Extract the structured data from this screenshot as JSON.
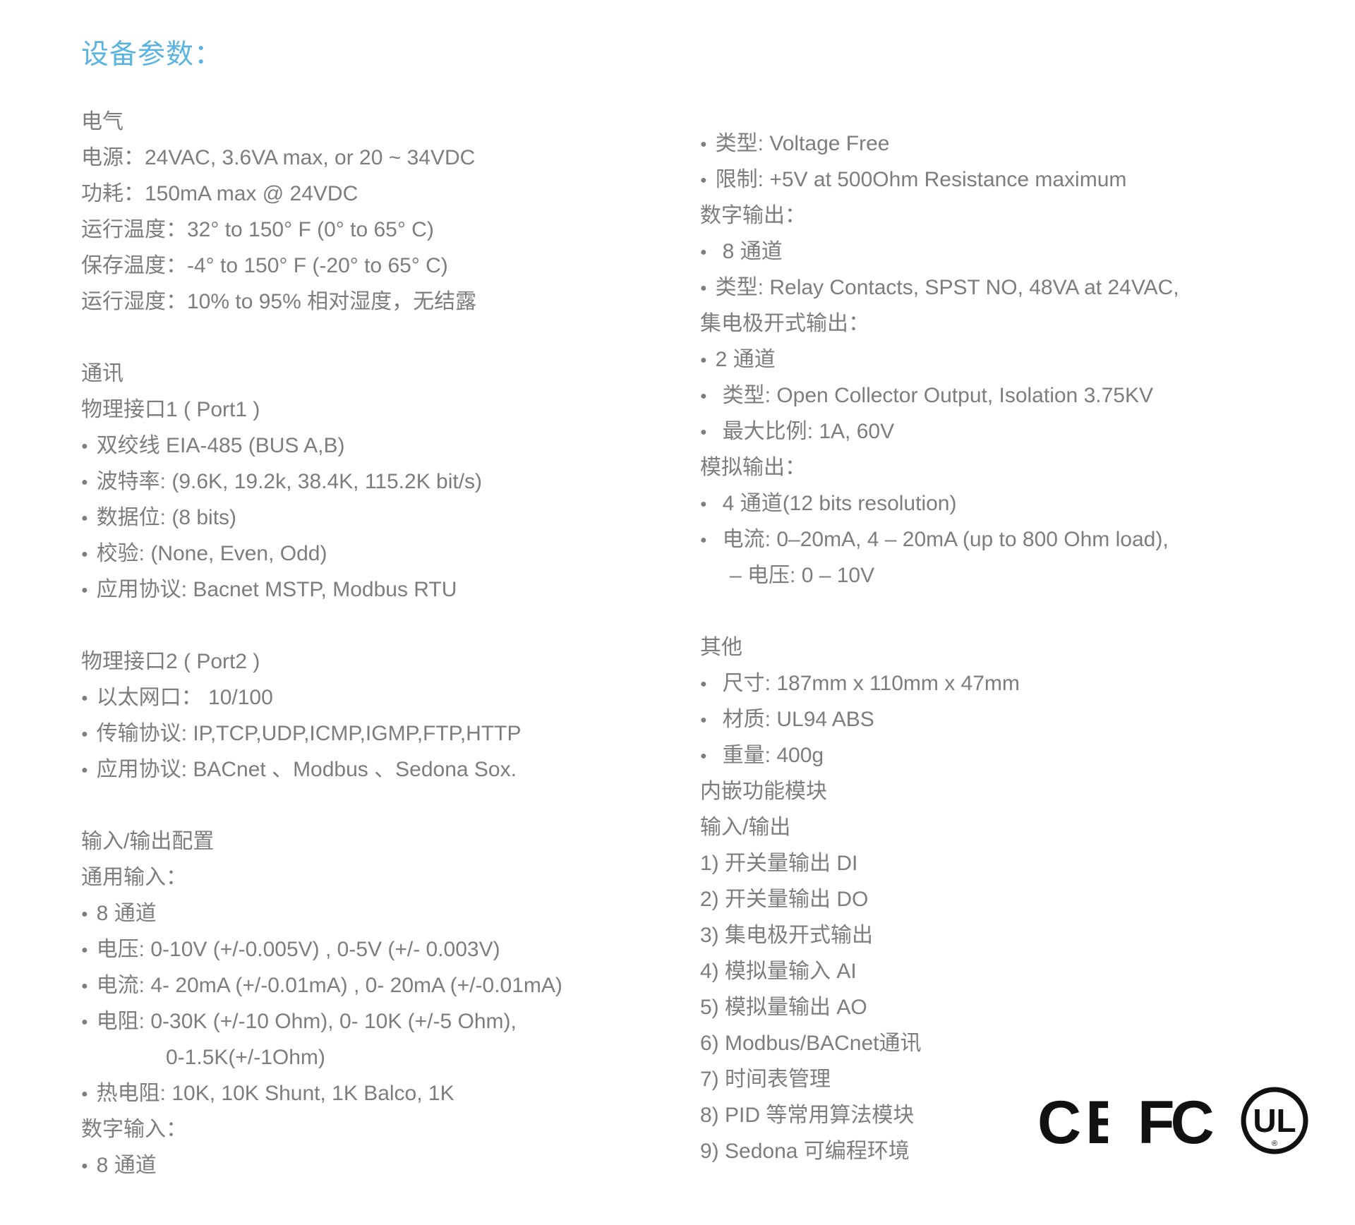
{
  "title": "设备参数：",
  "left_column": [
    {
      "text": "电气",
      "bullet": false
    },
    {
      "text": "电源：24VAC, 3.6VA max, or 20 ~ 34VDC",
      "bullet": false
    },
    {
      "text": "功耗：150mA max @ 24VDC",
      "bullet": false
    },
    {
      "text": "运行温度：32° to 150° F (0° to 65° C)",
      "bullet": false
    },
    {
      "text": "保存温度：-4° to 150° F (-20° to 65° C)",
      "bullet": false
    },
    {
      "text": "运行湿度：10% to 95% 相对湿度，无结露",
      "bullet": false
    },
    {
      "text": "",
      "gap": true
    },
    {
      "text": "通讯",
      "bullet": false
    },
    {
      "text": "物理接口1 ( Port1 )",
      "bullet": false
    },
    {
      "text": "双绞线 EIA-485 (BUS A,B)",
      "bullet": true
    },
    {
      "text": "波特率: (9.6K, 19.2k, 38.4K, 115.2K bit/s)",
      "bullet": true
    },
    {
      "text": "数据位: (8 bits)",
      "bullet": true
    },
    {
      "text": "校验: (None, Even, Odd)",
      "bullet": true
    },
    {
      "text": "应用协议: Bacnet MSTP, Modbus RTU",
      "bullet": true
    },
    {
      "text": "",
      "gap": true
    },
    {
      "text": "物理接口2 ( Port2 )",
      "bullet": false
    },
    {
      "text": "以太网口： 10/100",
      "bullet": true
    },
    {
      "text": "传输协议: IP,TCP,UDP,ICMP,IGMP,FTP,HTTP",
      "bullet": true
    },
    {
      "text": "应用协议: BACnet 、Modbus 、Sedona Sox.",
      "bullet": true
    },
    {
      "text": "",
      "gap": true
    },
    {
      "text": "输入/输出配置",
      "bullet": false
    },
    {
      "text": "通用输入：",
      "bullet": false
    },
    {
      "text": "8 通道",
      "bullet": true
    },
    {
      "text": "电压: 0-10V (+/-0.005V) , 0-5V (+/- 0.003V)",
      "bullet": true
    },
    {
      "text": "电流: 4- 20mA (+/-0.01mA) , 0- 20mA (+/-0.01mA)",
      "bullet": true
    },
    {
      "text": "电阻: 0-30K (+/-10 Ohm), 0- 10K (+/-5 Ohm),",
      "bullet": true
    },
    {
      "text": "0-1.5K(+/-1Ohm)",
      "bullet": false,
      "indent": true
    },
    {
      "text": "热电阻: 10K, 10K Shunt, 1K Balco, 1K",
      "bullet": true
    },
    {
      "text": "数字输入：",
      "bullet": false
    },
    {
      "text": "8 通道",
      "bullet": true
    }
  ],
  "right_column": [
    {
      "text": "类型: Voltage Free",
      "bullet": true
    },
    {
      "text": "限制: +5V at 500Ohm Resistance maximum",
      "bullet": true
    },
    {
      "text": "数字输出：",
      "bullet": false
    },
    {
      "text": "8 通道",
      "bullet": true,
      "wide": true
    },
    {
      "text": "类型: Relay Contacts, SPST NO, 48VA at 24VAC,",
      "bullet": true
    },
    {
      "text": "集电极开式输出：",
      "bullet": false
    },
    {
      "text": "2 通道",
      "bullet": true
    },
    {
      "text": "类型: Open Collector Output, Isolation 3.75KV",
      "bullet": true,
      "wide": true
    },
    {
      "text": "最大比例: 1A, 60V",
      "bullet": true,
      "wide": true
    },
    {
      "text": "模拟输出：",
      "bullet": false
    },
    {
      "text": "4 通道(12 bits resolution)",
      "bullet": true,
      "wide": true
    },
    {
      "text": "电流: 0–20mA, 4 – 20mA (up to 800 Ohm load),",
      "bullet": true,
      "wide": true
    },
    {
      "text": "– 电压: 0 – 10V",
      "bullet": false,
      "indent": true
    },
    {
      "text": "",
      "gap": true
    },
    {
      "text": "其他",
      "bullet": false
    },
    {
      "text": "尺寸: 187mm x 110mm x 47mm",
      "bullet": true,
      "wide": true
    },
    {
      "text": "材质: UL94 ABS",
      "bullet": true,
      "wide": true
    },
    {
      "text": "重量: 400g",
      "bullet": true,
      "wide": true
    },
    {
      "text": "内嵌功能模块",
      "bullet": false
    },
    {
      "text": "输入/输出",
      "bullet": false
    },
    {
      "text": "1) 开关量输出 DI",
      "bullet": false
    },
    {
      "text": "2) 开关量输出 DO",
      "bullet": false
    },
    {
      "text": "3) 集电极开式输出",
      "bullet": false
    },
    {
      "text": "4) 模拟量输入 AI",
      "bullet": false
    },
    {
      "text": "5) 模拟量输出 AO",
      "bullet": false
    },
    {
      "text": "6) Modbus/BACnet通讯",
      "bullet": false
    },
    {
      "text": "7) 时间表管理",
      "bullet": false
    },
    {
      "text": "8) PID 等常用算法模块",
      "bullet": false
    },
    {
      "text": "9) Sedona 可编程环境",
      "bullet": false
    }
  ],
  "certifications": [
    {
      "name": "ce-mark",
      "label": "CE"
    },
    {
      "name": "fcc-mark",
      "label": "FC"
    },
    {
      "name": "ul-mark",
      "label": "UL"
    }
  ]
}
